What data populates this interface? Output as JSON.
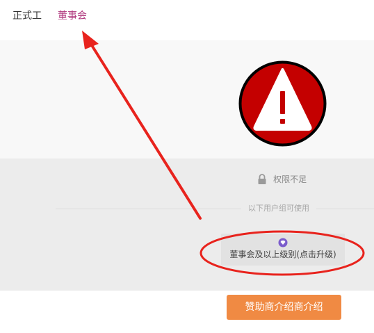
{
  "tabs": {
    "regular_label": "正式工",
    "board_label": "董事会"
  },
  "permission": {
    "notice": "权限不足",
    "group_label": "以下用户组可使用",
    "upgrade_label": "董事会及以上级别(点击升级)"
  },
  "sponsor": {
    "button_label": "赞助商介绍商介绍"
  },
  "icons": {
    "warning": "warning-icon",
    "lock": "lock-icon",
    "gem": "gem-icon"
  },
  "colors": {
    "active_tab": "#b0387e",
    "sponsor_button": "#f08a43",
    "warning_circle": "#c40000",
    "annotation": "#e8231d"
  }
}
